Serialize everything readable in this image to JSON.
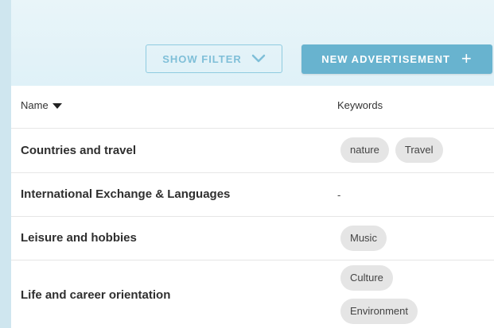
{
  "toolbar": {
    "show_filter_label": "SHOW FILTER",
    "new_ad_label": "NEW ADVERTISEMENT",
    "new_ad_plus": "+"
  },
  "table": {
    "headers": {
      "name": "Name",
      "keywords": "Keywords"
    },
    "rows": [
      {
        "name": "Countries and travel",
        "keywords": [
          "nature",
          "Travel"
        ]
      },
      {
        "name": "International Exchange & Languages",
        "keywords": [],
        "empty": "-"
      },
      {
        "name": "Leisure and hobbies",
        "keywords": [
          "Music"
        ]
      },
      {
        "name": "Life and career orientation",
        "keywords": [
          "Culture",
          "Environment"
        ]
      }
    ]
  },
  "colors": {
    "accent": "#68b3cf",
    "outline": "#8fcbe0",
    "chip_bg": "#e5e5e5"
  }
}
